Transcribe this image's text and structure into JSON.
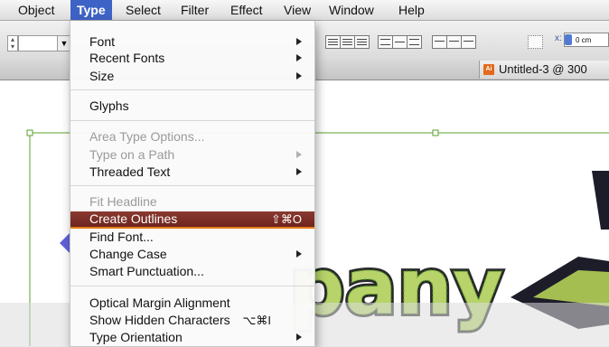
{
  "menubar": {
    "items": [
      {
        "label": "Object"
      },
      {
        "label": "Type"
      },
      {
        "label": "Select"
      },
      {
        "label": "Filter"
      },
      {
        "label": "Effect"
      },
      {
        "label": "View"
      },
      {
        "label": "Window"
      },
      {
        "label": "Help"
      }
    ],
    "active": "Type"
  },
  "controlbar": {
    "x_label": "x:",
    "x_value": "0 cm"
  },
  "document": {
    "tab_title": "Untitled-3 @ 300",
    "icon_text": "Ai"
  },
  "artwork": {
    "text": "pany",
    "fill": "#b7d36a",
    "outline": "#2a2a2a",
    "path_color": "#5aa02c",
    "accent": "#3a3ad0"
  },
  "type_menu": {
    "items": [
      {
        "label": "Font",
        "submenu": true
      },
      {
        "label": "Recent Fonts",
        "submenu": true
      },
      {
        "label": "Size",
        "submenu": true
      },
      {
        "label": "Glyphs"
      },
      {
        "label": "Area Type Options...",
        "disabled": true
      },
      {
        "label": "Type on a Path",
        "submenu": true,
        "disabled": true
      },
      {
        "label": "Threaded Text",
        "submenu": true
      },
      {
        "label": "Fit Headline",
        "disabled": true
      },
      {
        "label": "Create Outlines",
        "shortcut": "⇧⌘O",
        "highlighted": true
      },
      {
        "label": "Find Font..."
      },
      {
        "label": "Change Case",
        "submenu": true
      },
      {
        "label": "Smart Punctuation..."
      },
      {
        "label": "Optical Margin Alignment"
      },
      {
        "label": "Show Hidden Characters",
        "shortcut": "⌥⌘I"
      },
      {
        "label": "Type Orientation",
        "submenu": true
      }
    ],
    "highlight_color": "#7a2c24",
    "highlight_underline": "#e37a18"
  }
}
